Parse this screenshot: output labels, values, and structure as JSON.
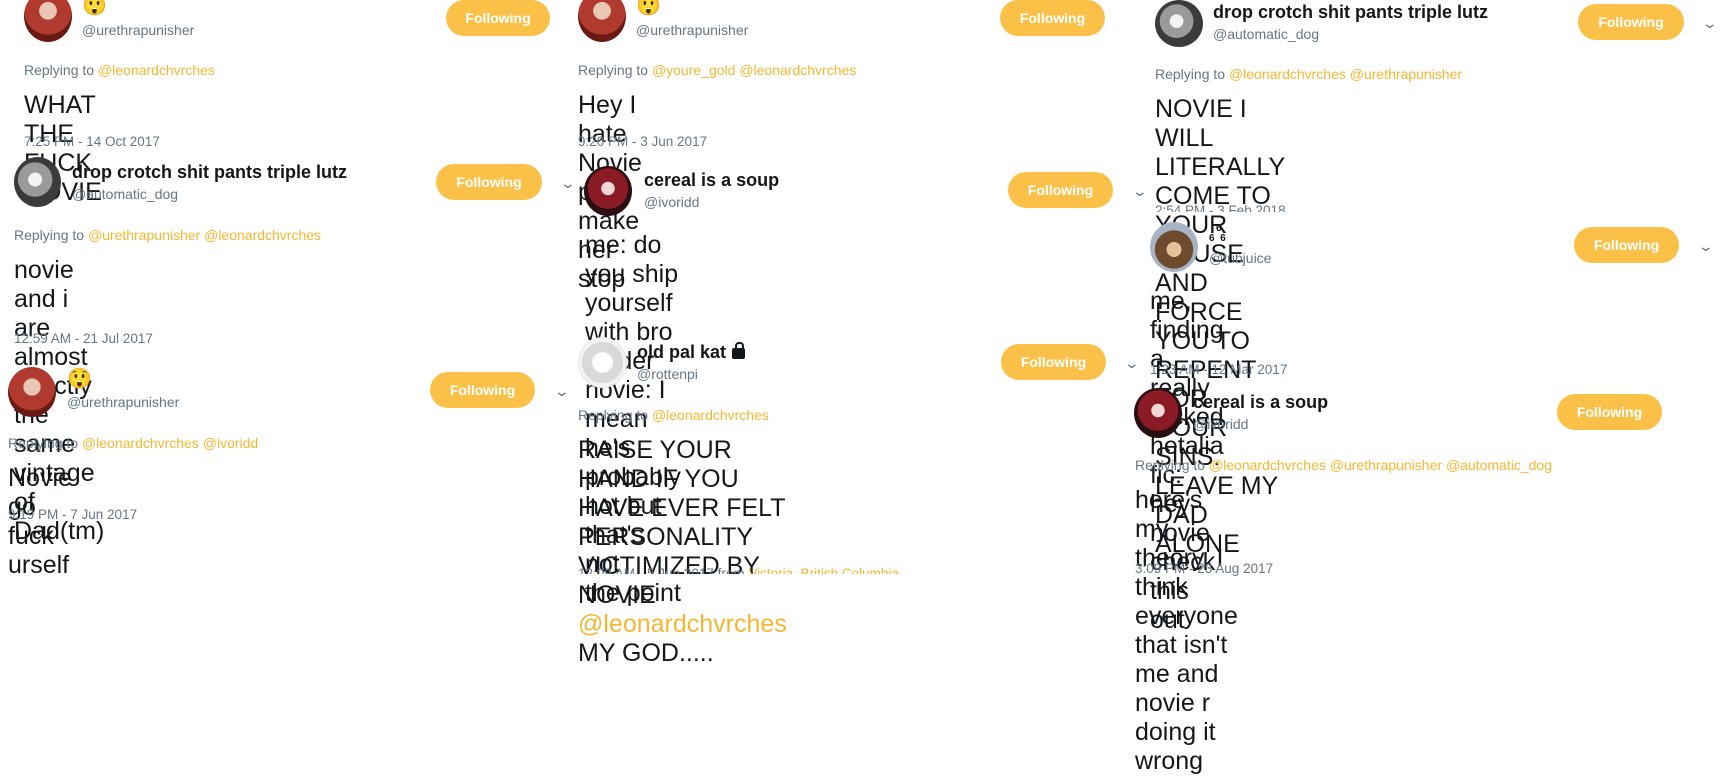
{
  "follow_label": "Following",
  "icons": {
    "dropdown": "chevron-down-icon",
    "lock": "lock-icon"
  },
  "tweets": [
    {
      "emoji_name": "😲",
      "handle": "@urethrapunisher",
      "replying_prefix": "Replying to",
      "mentions": [
        "@leonardchvrches"
      ],
      "text": "WHAT THE FUCK NOVIE",
      "time": "7:25 PM - 14 Oct 2017"
    },
    {
      "name": "drop crotch shit pants triple lutz",
      "handle": "@automatic_dog",
      "replying_prefix": "Replying to",
      "mentions": [
        "@urethrapunisher",
        "@leonardchvrches"
      ],
      "text_lines": [
        "novie and i are almost exactly the same",
        "vintage of Dad(tm)"
      ],
      "time": "12:59 AM - 21 Jul 2017"
    },
    {
      "emoji_name": "😲",
      "handle": "@urethrapunisher",
      "replying_prefix": "Replying to",
      "mentions": [
        "@leonardchvrches",
        "@ivoridd"
      ],
      "text": "Novie go fuck urself",
      "time": "9:19 PM - 7 Jun 2017"
    },
    {
      "emoji_name": "😲",
      "handle": "@urethrapunisher",
      "replying_prefix": "Replying to",
      "mentions": [
        "@youre_gold",
        "@leonardchvrches"
      ],
      "text": "Hey I hate Novie pls make her stop",
      "time": "9:20 PM - 3 Jun 2017"
    },
    {
      "name": "cereal is a soup",
      "handle": "@ivoridd",
      "text_lines": [
        "me: do you ship yourself with bro strider",
        "novie: I mean he's probably hot but that's not",
        "the point"
      ]
    },
    {
      "name": "old pal kat",
      "handle": "@rottenpi",
      "replying_prefix": "Replying to",
      "mentions": [
        "@leonardchvrches"
      ],
      "text_lines": [
        "RAISE YOUR HAND IF YOU HAVE EVER FELT",
        "PERSONALITY VICTIMIZED BY NOVIE"
      ],
      "text_mention": "@leonardchvrches",
      "text_tail": "MY GOD.....",
      "time": "12:09 AM - 5 Jun 2017 from",
      "location": "Victoria, British Columbia"
    },
    {
      "name": "drop crotch shit pants triple lutz",
      "handle": "@automatic_dog",
      "replying_prefix": "Replying to",
      "mentions": [
        "@leonardchvrches",
        "@urethrapunisher"
      ],
      "text_lines": [
        "NOVIE I WILL LITERALLY COME TO YOUR",
        "HOUSE AND FORCE YOU TO REPENT FOR",
        "YOUR SINS. LEAVE MY DAD ALONE"
      ],
      "time": "2:54 PM - 3 Feb 2018"
    },
    {
      "name_top": "6",
      "name_bottom": "6  6",
      "handle": "@tubjuice",
      "text_lines": [
        "me, finding a really fucked hetalia fic: hey",
        "novie check this out"
      ],
      "time": "1:23 AM - 12 Mar 2017"
    },
    {
      "name": "cereal is a soup",
      "handle": "@ivoridd",
      "replying_prefix": "Replying to",
      "mentions": [
        "@leonardchvrches",
        "@urethrapunisher",
        "@automatic_dog"
      ],
      "text_lines": [
        "here's my theory. I think everyone that isn't",
        "me and novie r doing it wrong"
      ],
      "time": "3:09 PM - 23 Aug 2017"
    }
  ]
}
